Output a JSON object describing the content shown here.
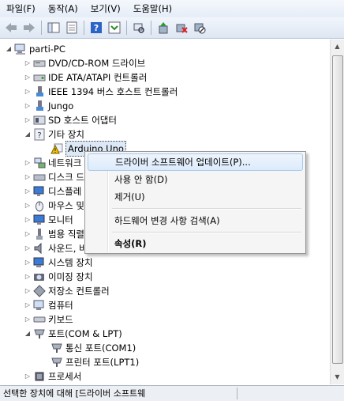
{
  "menubar": {
    "items": [
      "파일(F)",
      "동작(A)",
      "보기(V)",
      "도움말(H)"
    ]
  },
  "toolbar": {
    "buttons": [
      "back-icon",
      "forward-icon",
      "show-hide-tree-icon",
      "properties-icon",
      "help-icon",
      "action-pane-icon",
      "scan-hardware-icon",
      "update-driver-icon",
      "uninstall-icon",
      "disable-icon"
    ]
  },
  "tree": {
    "root": "parti-PC",
    "items": [
      {
        "label": "DVD/CD-ROM 드라이브",
        "icon": "dvd-drive-icon"
      },
      {
        "label": "IDE ATA/ATAPI 컨트롤러",
        "icon": "ide-controller-icon"
      },
      {
        "label": "IEEE 1394 버스 호스트 컨트롤러",
        "icon": "ieee1394-icon"
      },
      {
        "label": "Jungo",
        "icon": "device-icon"
      },
      {
        "label": "SD 호스트 어댑터",
        "icon": "sd-adapter-icon"
      },
      {
        "label": "기타 장치",
        "icon": "unknown-device-icon"
      },
      {
        "label": "Arduino Uno",
        "icon": "warning-device-icon"
      },
      {
        "label": "네트워크",
        "icon": "network-icon"
      },
      {
        "label": "디스크 드",
        "icon": "disk-drive-icon"
      },
      {
        "label": "디스플레",
        "icon": "display-adapter-icon"
      },
      {
        "label": "마우스 및",
        "icon": "mouse-icon"
      },
      {
        "label": "모니터",
        "icon": "monitor-icon"
      },
      {
        "label": "범용 직렬",
        "icon": "usb-controller-icon"
      },
      {
        "label": "사운드, 비",
        "icon": "sound-icon"
      },
      {
        "label": "시스템 장치",
        "icon": "system-device-icon"
      },
      {
        "label": "이미징 장치",
        "icon": "imaging-device-icon"
      },
      {
        "label": "저장소 컨트롤러",
        "icon": "storage-controller-icon"
      },
      {
        "label": "컴퓨터",
        "icon": "computer-icon"
      },
      {
        "label": "키보드",
        "icon": "keyboard-icon"
      },
      {
        "label": "포트(COM & LPT)",
        "icon": "port-icon"
      },
      {
        "label": "통신 포트(COM1)",
        "icon": "port-icon"
      },
      {
        "label": "프린터 포트(LPT1)",
        "icon": "port-icon"
      },
      {
        "label": "프로세서",
        "icon": "processor-icon"
      }
    ]
  },
  "context_menu": {
    "items": [
      {
        "label": "드라이버 소프트웨어 업데이트(P)..."
      },
      {
        "label": "사용 안 함(D)"
      },
      {
        "label": "제거(U)"
      },
      {
        "label": "하드웨어 변경 사항 검색(A)"
      },
      {
        "label": "속성(R)"
      }
    ]
  },
  "statusbar": {
    "text": "선택한 장치에 대해 [드라이버 소프트웨"
  },
  "colors": {
    "selection": "#dde8f6",
    "highlight_border": "#a8c8ec",
    "warning": "#f2c200"
  }
}
